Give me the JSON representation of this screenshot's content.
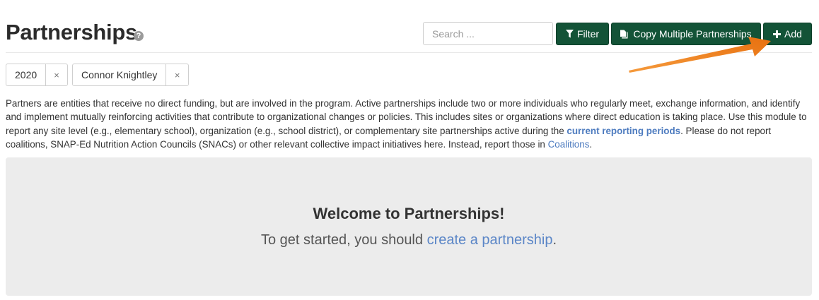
{
  "header": {
    "title": "Partnerships",
    "help_icon": "question-circle-icon",
    "help_glyph": "?"
  },
  "toolbar": {
    "search_placeholder": "Search ...",
    "filter_label": "Filter",
    "filter_icon": "filter-icon",
    "copy_label": "Copy Multiple Partnerships",
    "copy_icon": "copy-icon",
    "add_label": "Add",
    "add_icon": "plus-icon",
    "accent_color": "#135337"
  },
  "filters": [
    {
      "label": "2020",
      "remove": "×"
    },
    {
      "label": "Connor Knightley",
      "remove": "×"
    }
  ],
  "description": {
    "part1": "Partners are entities that receive no direct funding, but are involved in the program. Active partnerships include two or more individuals who regularly meet, exchange information, and identify and implement mutually reinforcing activities that contribute to organizational changes or policies. This includes sites or organizations where direct education is taking place. Use this module to report any site level (e.g., elementary school), organization (e.g., school district), or complementary site partnerships active during the ",
    "link1": "current reporting periods",
    "part2": ". Please do not report coalitions, SNAP-Ed Nutrition Action Councils (SNACs) or other relevant collective impact initiatives here. Instead, report those in ",
    "link2": "Coalitions",
    "part3": ".",
    "link_color": "#4d7bbf"
  },
  "welcome": {
    "title": "Welcome to Partnerships!",
    "text_before": "To get started, you should ",
    "link": "create a partnership",
    "text_after": "."
  },
  "annotation": {
    "arrow_color": "#f07d1c",
    "arrow_icon": "annotation-arrow-icon"
  }
}
